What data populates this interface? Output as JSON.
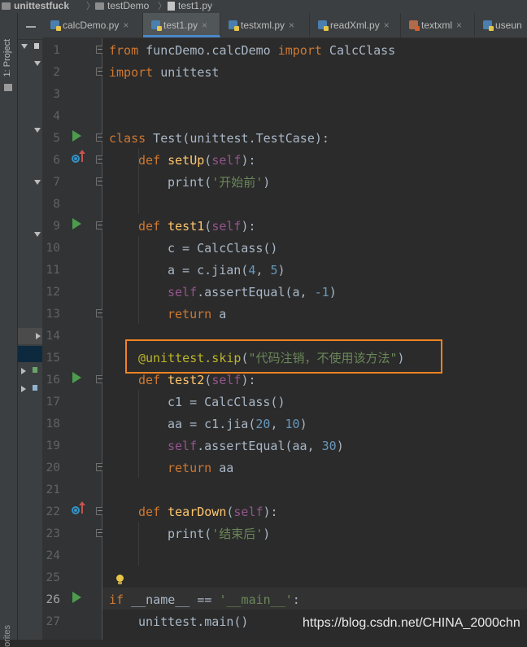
{
  "breadcrumbs": [
    "unittestfuck",
    "testDemo",
    "test1.py"
  ],
  "tool_window": {
    "project_label": "1: Project",
    "favorites_label": "orites"
  },
  "tabs": [
    {
      "label": "calcDemo.py",
      "active": false,
      "icon": "python-file-icon"
    },
    {
      "label": "test1.py",
      "active": true,
      "icon": "python-file-icon"
    },
    {
      "label": "testxml.py",
      "active": false,
      "icon": "python-file-icon"
    },
    {
      "label": "readXml.py",
      "active": false,
      "icon": "python-file-icon"
    },
    {
      "label": "textxml",
      "active": false,
      "icon": "xml-file-icon"
    },
    {
      "label": "useun",
      "active": false,
      "icon": "python-file-icon"
    }
  ],
  "tab_close_glyph": "×",
  "line_numbers": [
    "1",
    "2",
    "3",
    "4",
    "5",
    "6",
    "7",
    "8",
    "9",
    "10",
    "11",
    "12",
    "13",
    "14",
    "15",
    "16",
    "17",
    "18",
    "19",
    "20",
    "21",
    "22",
    "23",
    "24",
    "25",
    "26",
    "27"
  ],
  "current_line": 26,
  "code": {
    "l1": [
      "from",
      " funcDemo.calcDemo ",
      "import",
      " CalcClass"
    ],
    "l2": [
      "import",
      " unittest"
    ],
    "l5": [
      "class",
      " Test(unittest.TestCase):"
    ],
    "l6": [
      "def ",
      "setUp",
      "(",
      "self",
      "):"
    ],
    "l7": [
      "print(",
      "'开始前'",
      ")"
    ],
    "l9": [
      "def ",
      "test1",
      "(",
      "self",
      "):"
    ],
    "l10": [
      "c = CalcClass()"
    ],
    "l11": [
      "a = c.jian(",
      "4",
      ", ",
      "5",
      ")"
    ],
    "l12": [
      "self",
      ".assertEqual(a, ",
      "-1",
      ")"
    ],
    "l13": [
      "return",
      " a"
    ],
    "l15": [
      "@unittest.skip",
      "(",
      "\"代码注销，不使用该方法\"",
      ")"
    ],
    "l16": [
      "def ",
      "test2",
      "(",
      "self",
      "):"
    ],
    "l17": [
      "c1 = CalcClass()"
    ],
    "l18": [
      "aa = c1.jia(",
      "20",
      ", ",
      "10",
      ")"
    ],
    "l19": [
      "self",
      ".assertEqual(aa, ",
      "30",
      ")"
    ],
    "l20": [
      "return",
      " aa"
    ],
    "l22": [
      "def ",
      "tearDown",
      "(",
      "self",
      "):"
    ],
    "l23": [
      "print(",
      "'结束后'",
      ")"
    ],
    "l26": [
      "if",
      " __name__ == ",
      "'__main__'",
      ":"
    ],
    "l27": [
      "unittest.main()"
    ]
  },
  "watermark": "https://blog.csdn.net/CHINA_2000chn",
  "colors": {
    "keyword": "#cc7832",
    "self": "#94558d",
    "number": "#6897bb",
    "string": "#6a8759",
    "decorator": "#bbb529",
    "highlight_box": "#f08322"
  }
}
